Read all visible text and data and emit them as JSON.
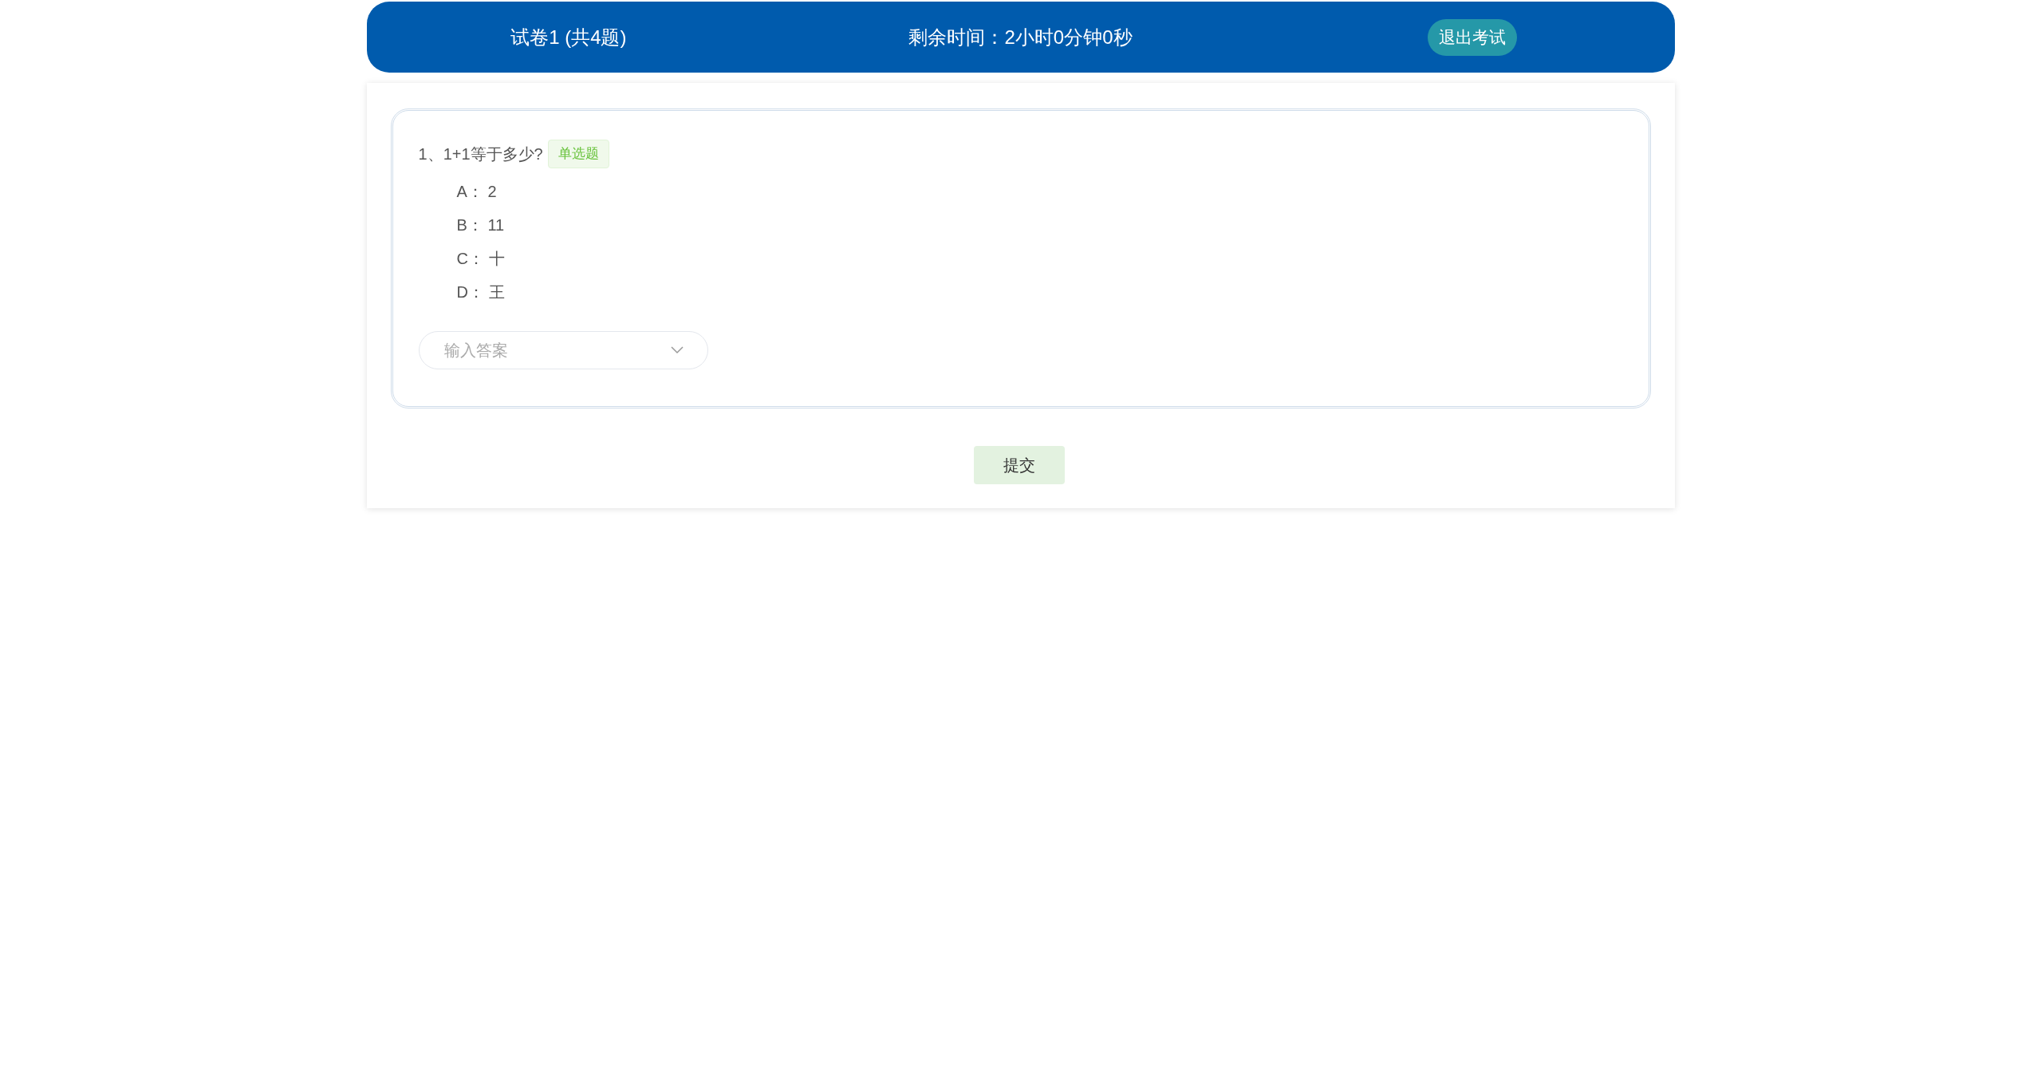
{
  "header": {
    "title": "试卷1 (共4题)",
    "timer": "剩余时间：2小时0分钟0秒",
    "exit_button": "退出考试"
  },
  "questions": [
    {
      "number": "1、",
      "text": "1+1等于多少?",
      "type_tag": "单选题",
      "options": [
        {
          "label": "A：",
          "text": "2"
        },
        {
          "label": "B：",
          "text": "11"
        },
        {
          "label": "C：",
          "text": "十"
        },
        {
          "label": "D：",
          "text": "王"
        }
      ],
      "answer": {
        "placeholder": "输入答案"
      }
    }
  ],
  "submit_button": "提交"
}
